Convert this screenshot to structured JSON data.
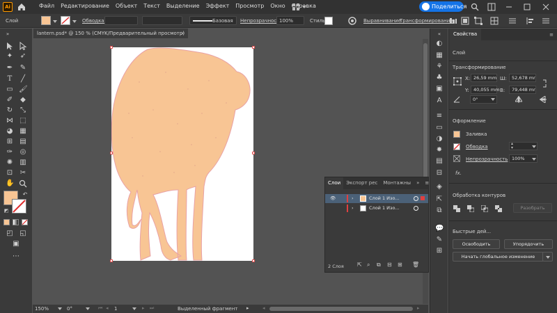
{
  "app": {
    "logo": "Ai"
  },
  "menu": [
    "Файл",
    "Редактирование",
    "Объект",
    "Текст",
    "Выделение",
    "Эффект",
    "Просмотр",
    "Окно",
    "Справка"
  ],
  "share": {
    "label": "Поделиться"
  },
  "controlbar": {
    "selection_label": "Слой",
    "fill_color": "#f8c594",
    "stroke_label": "Обводка:",
    "stroke_style": "Базовая",
    "opacity_label": "Непрозрачность:",
    "opacity_value": "100%",
    "style_label": "Стиль:",
    "align_label": "Выравнивание",
    "transform_label": "Трансформирование"
  },
  "document": {
    "tab_title": "lantern.psd* @ 150 % (CMYK/Предварительный просмотр)",
    "close": "×"
  },
  "status": {
    "zoom": "150%",
    "rotation": "0°",
    "artboard": "1",
    "tool": "Выделенный фрагмент"
  },
  "layers_panel": {
    "tabs": [
      "Слои",
      "Экспорт рес",
      "Монтажны"
    ],
    "rows": [
      {
        "name": "Слой 1 Изо...",
        "selected": true
      },
      {
        "name": "Слой 1 Изо...",
        "selected": false
      }
    ],
    "count": "2 Слоя"
  },
  "properties": {
    "tabs": [
      "Свойства"
    ],
    "section_layer": "Слой",
    "transform_title": "Трансформирование",
    "x": "26,59 mm",
    "y": "40,055 mm",
    "w": "52,678 mr",
    "h": "79,448 mr",
    "x_label": "X:",
    "y_label": "Y:",
    "w_label": "Ш:",
    "h_label": "В:",
    "angle": "0°",
    "appearance_title": "Оформление",
    "fill_label": "Заливка",
    "stroke_label": "Обводка",
    "opacity_label": "Непрозрачность",
    "opacity_value": "100%",
    "fx": "fx.",
    "pathfinder_title": "Обработка контуров",
    "pathfinder_button": "Разобрать",
    "quick_title": "Быстрые дей...",
    "release_button": "Освободить",
    "arrange_button": "Упорядочить",
    "global_edit_button": "Начать глобальное изменение"
  },
  "colors": {
    "accent": "#1473e6",
    "shape_fill": "#f8c594",
    "shape_stroke": "#e8a1a5",
    "layer_red": "#e04040"
  }
}
